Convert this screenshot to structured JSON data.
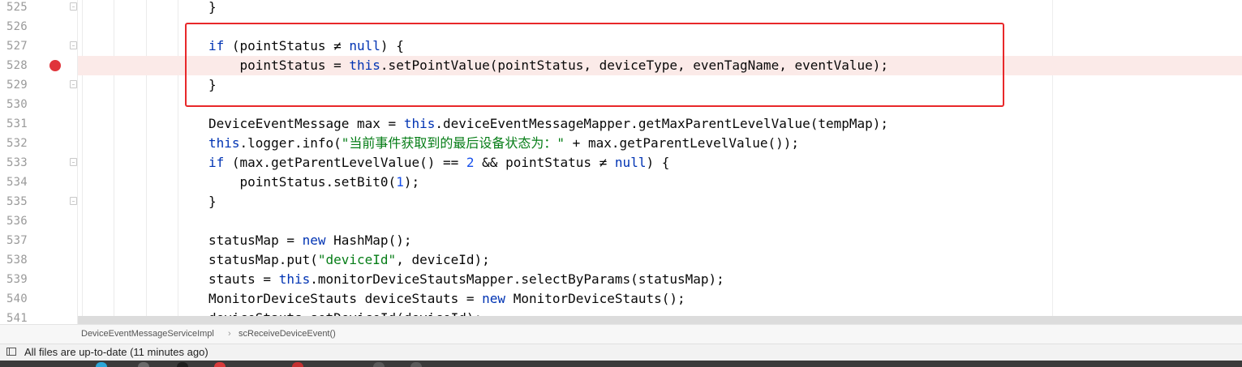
{
  "editor": {
    "lines": [
      {
        "num": "525",
        "fold": true,
        "breakpoint": false,
        "tokens": [
          {
            "t": "}",
            "c": ""
          }
        ]
      },
      {
        "num": "526",
        "fold": false,
        "breakpoint": false,
        "tokens": []
      },
      {
        "num": "527",
        "fold": true,
        "breakpoint": false,
        "tokens": [
          {
            "t": "if",
            "c": "kw"
          },
          {
            "t": " (pointStatus ≠ ",
            "c": ""
          },
          {
            "t": "null",
            "c": "kw"
          },
          {
            "t": ") {",
            "c": ""
          }
        ]
      },
      {
        "num": "528",
        "fold": false,
        "breakpoint": true,
        "tokens": [
          {
            "t": "    pointStatus = ",
            "c": ""
          },
          {
            "t": "this",
            "c": "kw"
          },
          {
            "t": ".setPointValue(pointStatus, deviceType, evenTagName, eventValue);",
            "c": ""
          }
        ]
      },
      {
        "num": "529",
        "fold": true,
        "breakpoint": false,
        "tokens": [
          {
            "t": "}",
            "c": ""
          }
        ]
      },
      {
        "num": "530",
        "fold": false,
        "breakpoint": false,
        "tokens": []
      },
      {
        "num": "531",
        "fold": false,
        "breakpoint": false,
        "tokens": [
          {
            "t": "DeviceEventMessage max = ",
            "c": ""
          },
          {
            "t": "this",
            "c": "kw"
          },
          {
            "t": ".deviceEventMessageMapper.getMaxParentLevelValue(tempMap);",
            "c": ""
          }
        ]
      },
      {
        "num": "532",
        "fold": false,
        "breakpoint": false,
        "tokens": [
          {
            "t": "this",
            "c": "kw"
          },
          {
            "t": ".logger.info(",
            "c": ""
          },
          {
            "t": "\"当前事件获取到的最后设备状态为：\"",
            "c": "str"
          },
          {
            "t": " + max.getParentLevelValue());",
            "c": ""
          }
        ]
      },
      {
        "num": "533",
        "fold": true,
        "breakpoint": false,
        "tokens": [
          {
            "t": "if",
            "c": "kw"
          },
          {
            "t": " (max.getParentLevelValue() == ",
            "c": ""
          },
          {
            "t": "2",
            "c": "num"
          },
          {
            "t": " && pointStatus ≠ ",
            "c": ""
          },
          {
            "t": "null",
            "c": "kw"
          },
          {
            "t": ") {",
            "c": ""
          }
        ]
      },
      {
        "num": "534",
        "fold": false,
        "breakpoint": false,
        "tokens": [
          {
            "t": "    pointStatus.setBit0(",
            "c": ""
          },
          {
            "t": "1",
            "c": "num"
          },
          {
            "t": ");",
            "c": ""
          }
        ]
      },
      {
        "num": "535",
        "fold": true,
        "breakpoint": false,
        "tokens": [
          {
            "t": "}",
            "c": ""
          }
        ]
      },
      {
        "num": "536",
        "fold": false,
        "breakpoint": false,
        "tokens": []
      },
      {
        "num": "537",
        "fold": false,
        "breakpoint": false,
        "tokens": [
          {
            "t": "statusMap = ",
            "c": ""
          },
          {
            "t": "new",
            "c": "kw"
          },
          {
            "t": " HashMap();",
            "c": ""
          }
        ]
      },
      {
        "num": "538",
        "fold": false,
        "breakpoint": false,
        "tokens": [
          {
            "t": "statusMap.put(",
            "c": ""
          },
          {
            "t": "\"deviceId\"",
            "c": "str"
          },
          {
            "t": ", deviceId);",
            "c": ""
          }
        ]
      },
      {
        "num": "539",
        "fold": false,
        "breakpoint": false,
        "tokens": [
          {
            "t": "stauts = ",
            "c": ""
          },
          {
            "t": "this",
            "c": "kw"
          },
          {
            "t": ".monitorDeviceStautsMapper.selectByParams(statusMap);",
            "c": ""
          }
        ]
      },
      {
        "num": "540",
        "fold": false,
        "breakpoint": false,
        "tokens": [
          {
            "t": "MonitorDeviceStauts deviceStauts = ",
            "c": ""
          },
          {
            "t": "new",
            "c": "kw"
          },
          {
            "t": " MonitorDeviceStauts();",
            "c": ""
          }
        ]
      },
      {
        "num": "541",
        "fold": false,
        "breakpoint": false,
        "tokens": [
          {
            "t": "deviceStauts.setDeviceId(deviceId);",
            "c": ""
          }
        ]
      }
    ]
  },
  "breadcrumb": {
    "class_name": "DeviceEventMessageServiceImpl",
    "separator": "›",
    "method_name": "scReceiveDeviceEvent()"
  },
  "status": {
    "text": "All files are up-to-date (11 minutes ago)",
    "icon": "panel-toggle-icon"
  },
  "colors": {
    "keyword": "#0033b3",
    "string": "#067d17",
    "number": "#1750eb",
    "breakpoint": "#e0343b",
    "highlight_box": "#e8282a"
  }
}
